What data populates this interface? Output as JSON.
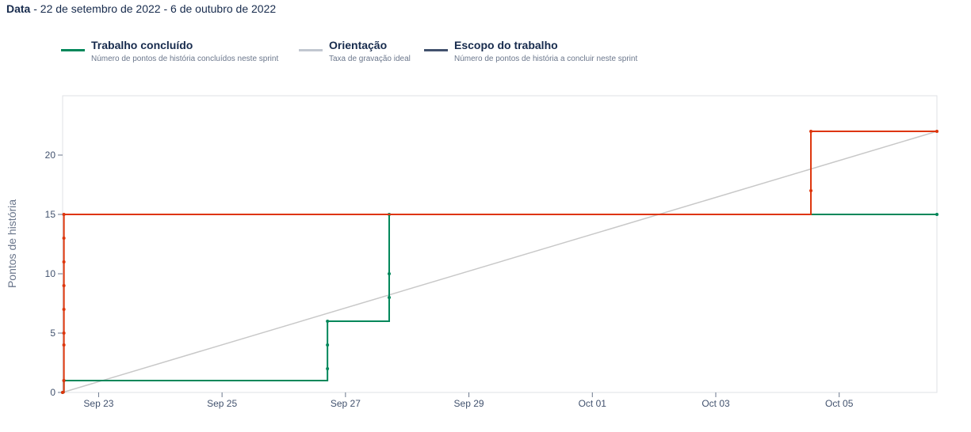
{
  "header": {
    "label": "Data",
    "range": " - 22 de setembro de 2022 - 6 de outubro de 2022"
  },
  "legend": [
    {
      "title": "Trabalho concluído",
      "desc": "Número de pontos de história concluídos neste sprint",
      "color": "#00875a"
    },
    {
      "title": "Orientação",
      "desc": "Taxa de gravação ideal",
      "color": "#c1c7d0"
    },
    {
      "title": "Escopo do trabalho",
      "desc": "Número de pontos de história a concluir neste sprint",
      "color": "#42526e"
    }
  ],
  "chart_data": {
    "type": "line",
    "ylabel": "Pontos de história",
    "ylim": [
      0,
      25
    ],
    "yticks": [
      0,
      5,
      10,
      15,
      20
    ],
    "xlim": [
      "2022-09-22T10:00",
      "2022-10-06T14:00"
    ],
    "xticks": [
      {
        "date": "2022-09-23",
        "label": "Sep 23"
      },
      {
        "date": "2022-09-25",
        "label": "Sep 25"
      },
      {
        "date": "2022-09-27",
        "label": "Sep 27"
      },
      {
        "date": "2022-09-29",
        "label": "Sep 29"
      },
      {
        "date": "2022-10-01",
        "label": "Oct 01"
      },
      {
        "date": "2022-10-03",
        "label": "Oct 03"
      },
      {
        "date": "2022-10-05",
        "label": "Oct 05"
      }
    ],
    "grid": false,
    "series": [
      {
        "name": "Orientação",
        "color": "#c8c8c8",
        "step": false,
        "points": [
          [
            "2022-09-22T10:00",
            0
          ],
          [
            "2022-10-06T14:00",
            22
          ]
        ]
      },
      {
        "name": "Trabalho concluído",
        "color": "#00875a",
        "step": true,
        "points": [
          [
            "2022-09-22T10:00",
            0
          ],
          [
            "2022-09-22T10:30",
            1
          ],
          [
            "2022-09-26T17:00",
            2
          ],
          [
            "2022-09-26T17:00",
            4
          ],
          [
            "2022-09-26T17:00",
            6
          ],
          [
            "2022-09-27T17:00",
            8
          ],
          [
            "2022-09-27T17:00",
            10
          ],
          [
            "2022-09-27T17:00",
            15
          ],
          [
            "2022-10-06T14:00",
            15
          ]
        ]
      },
      {
        "name": "Escopo do trabalho",
        "color": "#de350b",
        "step": true,
        "points": [
          [
            "2022-09-22T10:00",
            0
          ],
          [
            "2022-09-22T10:30",
            1
          ],
          [
            "2022-09-22T10:30",
            4
          ],
          [
            "2022-09-22T10:30",
            5
          ],
          [
            "2022-09-22T10:30",
            7
          ],
          [
            "2022-09-22T10:30",
            9
          ],
          [
            "2022-09-22T10:30",
            11
          ],
          [
            "2022-09-22T10:30",
            13
          ],
          [
            "2022-09-22T10:30",
            15
          ],
          [
            "2022-10-04T13:00",
            17
          ],
          [
            "2022-10-04T13:00",
            22
          ],
          [
            "2022-10-06T14:00",
            22
          ]
        ]
      }
    ]
  }
}
